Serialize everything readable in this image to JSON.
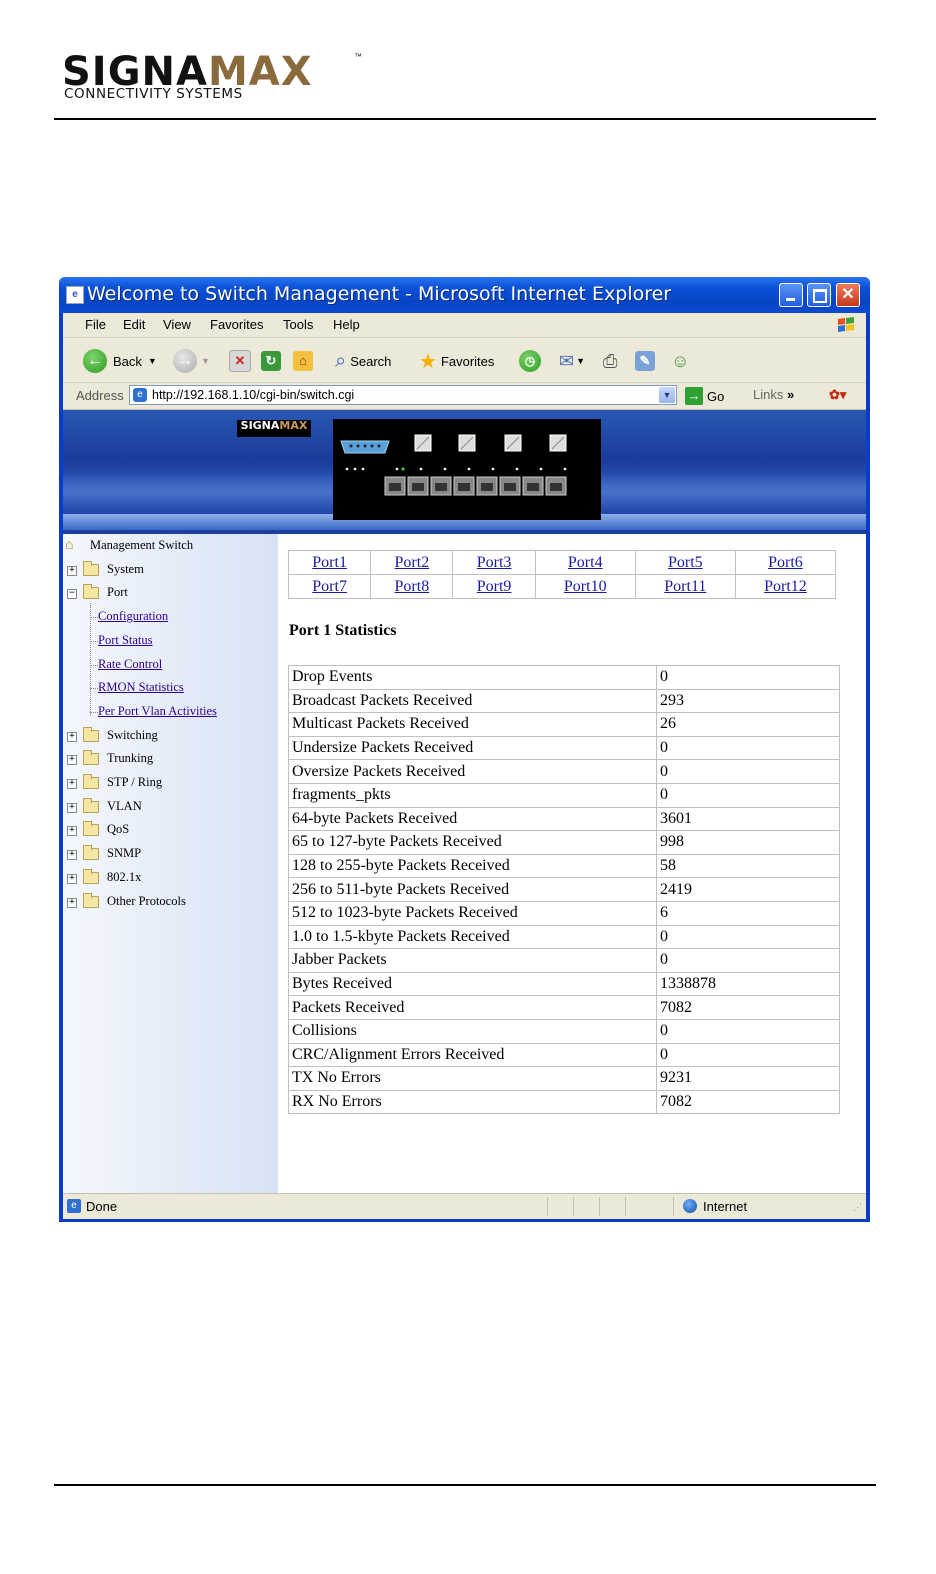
{
  "document": {
    "logo_main": "SIGNA",
    "logo_accent": "MAX",
    "logo_tm": "™",
    "logo_sub": "CONNECTIVITY SYSTEMS"
  },
  "window": {
    "title": "Welcome to Switch Management - Microsoft Internet Explorer"
  },
  "menu": [
    "File",
    "Edit",
    "View",
    "Favorites",
    "Tools",
    "Help"
  ],
  "toolbar": {
    "back": "Back",
    "search": "Search",
    "favorites": "Favorites"
  },
  "address": {
    "label": "Address",
    "url": "http://192.168.1.10/cgi-bin/switch.cgi",
    "go": "Go",
    "links": "Links",
    "links_more": "»"
  },
  "banner": {
    "logo_main": "SIGNA",
    "logo_accent": "MAX"
  },
  "sidebar": {
    "root": "Management Switch",
    "items": [
      {
        "label": "System",
        "expanded": false
      },
      {
        "label": "Port",
        "expanded": true
      },
      {
        "label": "Switching",
        "expanded": false
      },
      {
        "label": "Trunking",
        "expanded": false
      },
      {
        "label": "STP / Ring",
        "expanded": false
      },
      {
        "label": "VLAN",
        "expanded": false
      },
      {
        "label": "QoS",
        "expanded": false
      },
      {
        "label": "SNMP",
        "expanded": false
      },
      {
        "label": "802.1x",
        "expanded": false
      },
      {
        "label": "Other Protocols",
        "expanded": false
      }
    ],
    "port_children": [
      "Configuration",
      "Port Status",
      "Rate Control",
      "RMON Statistics",
      "Per Port Vlan Activities"
    ]
  },
  "ports": {
    "row1": [
      "Port1",
      "Port2",
      "Port3",
      "Port4",
      "Port5",
      "Port6"
    ],
    "row2": [
      "Port7",
      "Port8",
      "Port9",
      "Port10",
      "Port11",
      "Port12"
    ]
  },
  "stats": {
    "title": "Port 1 Statistics",
    "rows": [
      {
        "label": "Drop Events",
        "value": "0"
      },
      {
        "label": "Broadcast Packets Received",
        "value": "293"
      },
      {
        "label": "Multicast Packets Received",
        "value": "26"
      },
      {
        "label": "Undersize Packets Received",
        "value": "0"
      },
      {
        "label": "Oversize Packets Received",
        "value": "0"
      },
      {
        "label": "fragments_pkts",
        "value": "0"
      },
      {
        "label": "64-byte Packets Received",
        "value": "3601"
      },
      {
        "label": "65 to 127-byte Packets Received",
        "value": "998"
      },
      {
        "label": "128 to 255-byte Packets Received",
        "value": "58"
      },
      {
        "label": "256 to 511-byte Packets Received",
        "value": "2419"
      },
      {
        "label": "512 to 1023-byte Packets Received",
        "value": "6"
      },
      {
        "label": "1.0 to 1.5-kbyte Packets Received",
        "value": "0"
      },
      {
        "label": "Jabber Packets",
        "value": "0"
      },
      {
        "label": "Bytes Received",
        "value": "1338878"
      },
      {
        "label": "Packets Received",
        "value": "7082"
      },
      {
        "label": "Collisions",
        "value": "0"
      },
      {
        "label": "CRC/Alignment Errors Received",
        "value": "0"
      },
      {
        "label": "TX No Errors",
        "value": "9231"
      },
      {
        "label": "RX No Errors",
        "value": "7082"
      }
    ]
  },
  "status": {
    "text": "Done",
    "zone": "Internet"
  }
}
